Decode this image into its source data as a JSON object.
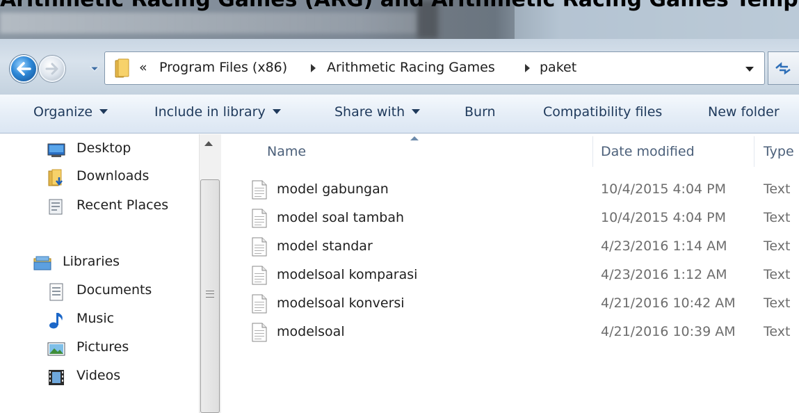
{
  "window": {
    "title": "Arithmetic Racing Games (ARG) and Arithmetic Racing Games Template"
  },
  "address_bar": {
    "overflow": "«",
    "breadcrumbs": [
      "Program Files (x86)",
      "Arithmetic Racing Games",
      "paket"
    ]
  },
  "toolbar": {
    "organize": "Organize",
    "include_in_library": "Include in library",
    "share_with": "Share with",
    "burn": "Burn",
    "compatibility_files": "Compatibility files",
    "new_folder": "New folder"
  },
  "navigation": {
    "favorites": [
      "Desktop",
      "Downloads",
      "Recent Places"
    ],
    "libraries": {
      "label": "Libraries",
      "items": [
        "Documents",
        "Music",
        "Pictures",
        "Videos"
      ]
    }
  },
  "columns": {
    "name": "Name",
    "date_modified": "Date modified",
    "type": "Type"
  },
  "files": [
    {
      "name": "model gabungan",
      "date": "10/4/2015 4:04 PM",
      "type": "Text"
    },
    {
      "name": "model soal tambah",
      "date": "10/4/2015 4:04 PM",
      "type": "Text"
    },
    {
      "name": "model standar",
      "date": "4/23/2016 1:14 AM",
      "type": "Text"
    },
    {
      "name": "modelsoal komparasi",
      "date": "4/23/2016 1:12 AM",
      "type": "Text"
    },
    {
      "name": "modelsoal konversi",
      "date": "4/21/2016 10:42 AM",
      "type": "Text"
    },
    {
      "name": "modelsoal",
      "date": "4/21/2016 10:39 AM",
      "type": "Text"
    }
  ],
  "icons": {
    "back": "back-arrow-icon",
    "forward": "forward-arrow-icon",
    "folder": "folder-icon",
    "text_file": "text-file-icon"
  }
}
